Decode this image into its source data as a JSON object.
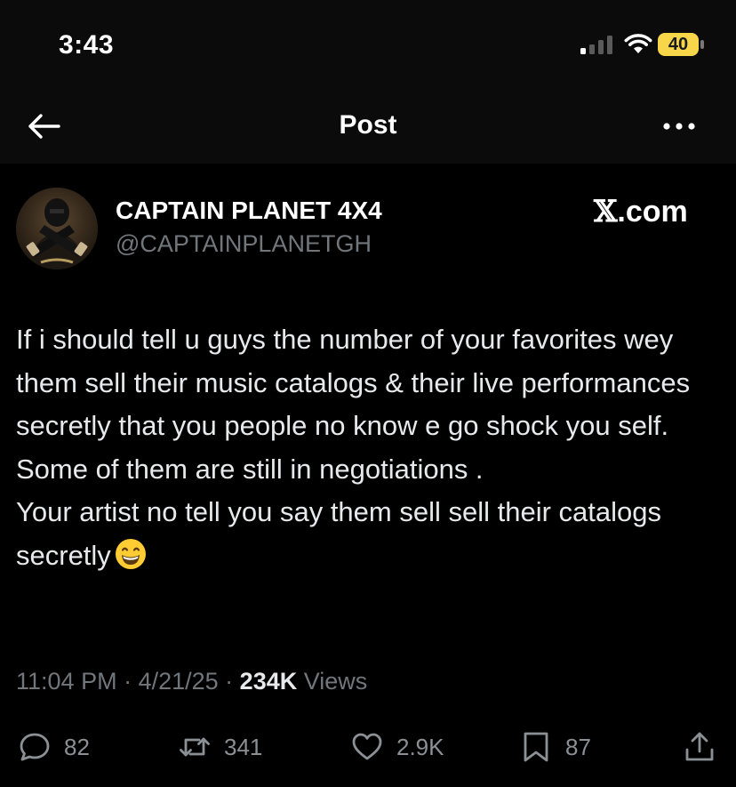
{
  "status_bar": {
    "time": "3:43",
    "battery": "40",
    "battery_color": "#f7d64a"
  },
  "nav": {
    "title": "Post",
    "back_icon": "arrow-left-icon",
    "more_icon": "ellipsis-icon"
  },
  "author": {
    "display_name": "CAPTAIN PLANET 4X4",
    "handle": "@CAPTAINPLANETGH"
  },
  "watermark": {
    "x_glyph": "𝕏",
    "domain": ".com"
  },
  "tweet": {
    "paragraph_1": "If i should tell u guys the number of your favorites wey them sell their music catalogs & their live performances secretly that you people no know e go shock you self.  Some of them are still in negotiations .",
    "paragraph_2": "Your artist no tell you say them sell sell their catalogs secretly",
    "emoji": "grinning-face-with-smiling-eyes"
  },
  "meta": {
    "time": "11:04 PM",
    "date": "4/21/25",
    "separator": " · ",
    "views_count": "234K",
    "views_label": "Views"
  },
  "actions": {
    "replies": "82",
    "reposts": "341",
    "likes": "2.9K",
    "bookmarks": "87"
  },
  "colors": {
    "background": "#000000",
    "text": "#e7e9ea",
    "secondary_text": "#71767b"
  }
}
